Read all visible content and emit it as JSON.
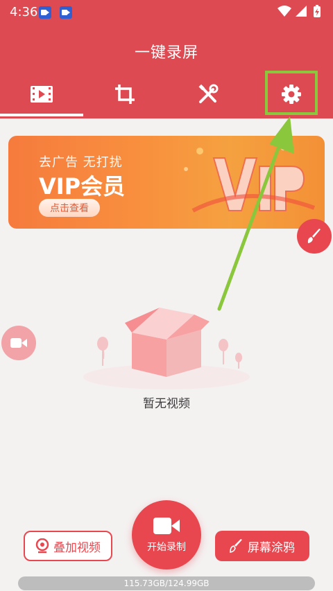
{
  "status_bar": {
    "time": "4:36",
    "notification_icons": [
      "video-camera-app-icon",
      "video-camera-app-icon"
    ],
    "right_icons": [
      "wifi-icon",
      "signal-icon",
      "battery-charging-icon"
    ]
  },
  "header": {
    "title": "一键录屏",
    "tabs": [
      {
        "name": "video-list",
        "icon": "film-icon",
        "selected": true
      },
      {
        "name": "crop",
        "icon": "crop-icon",
        "selected": false
      },
      {
        "name": "tools",
        "icon": "tools-icon",
        "selected": false
      },
      {
        "name": "settings",
        "icon": "gear-icon",
        "selected": false
      }
    ]
  },
  "banner": {
    "subtitle": "去广告 无打扰",
    "title": "VIP会员",
    "button": "点击查看"
  },
  "empty_state": {
    "text": "暂无视频"
  },
  "bottom_bar": {
    "overlay_video": "叠加视频",
    "start_record": "开始录制",
    "doodle": "屏幕涂鸦"
  },
  "storage": "115.73GB/124.99GB",
  "colors": {
    "primary": "#dd4a52",
    "banner_orange": "#f8913e",
    "highlight_green": "#8ac73c",
    "background": "#f4f1f1"
  }
}
